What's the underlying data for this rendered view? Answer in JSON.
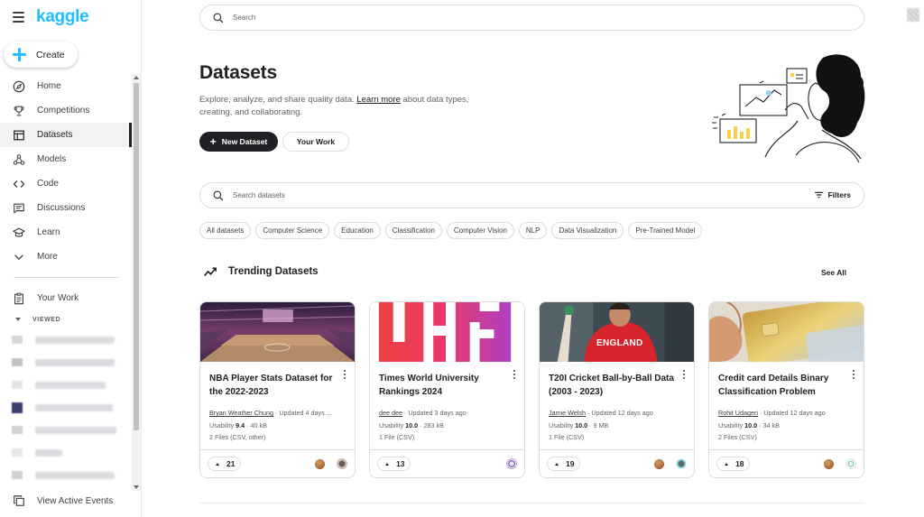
{
  "app": {
    "logo": "kaggle",
    "create_label": "Create",
    "search_placeholder": "Search"
  },
  "sidebar": {
    "items": [
      {
        "label": "Home",
        "icon": "compass-icon"
      },
      {
        "label": "Competitions",
        "icon": "trophy-icon"
      },
      {
        "label": "Datasets",
        "icon": "table-icon",
        "active": true
      },
      {
        "label": "Models",
        "icon": "models-icon"
      },
      {
        "label": "Code",
        "icon": "code-icon"
      },
      {
        "label": "Discussions",
        "icon": "comments-icon"
      },
      {
        "label": "Learn",
        "icon": "graduation-cap-icon"
      },
      {
        "label": "More",
        "icon": "chevron-down-icon"
      }
    ],
    "your_work": "Your Work",
    "viewed_header": "VIEWED",
    "active_events": "View Active Events"
  },
  "page": {
    "title": "Datasets",
    "desc_before": "Explore, analyze, and share quality data. ",
    "learn_more": "Learn more",
    "desc_after": " about data types, creating, and collaborating.",
    "new_dataset": "New Dataset",
    "your_work": "Your Work",
    "search_placeholder": "Search datasets",
    "filters": "Filters"
  },
  "chips": [
    "All datasets",
    "Computer Science",
    "Education",
    "Classification",
    "Computer Vision",
    "NLP",
    "Data Visualization",
    "Pre-Trained Model"
  ],
  "trending": {
    "title": "Trending Datasets",
    "see_all": "See All",
    "cards": [
      {
        "title": "NBA Player Stats Dataset for the 2022-2023",
        "author": "Bryan Weather Chung",
        "updated": " · Updated 4 days ...",
        "usability_label": "Usability ",
        "usability": "9.4",
        "size": " · 40 kB",
        "files": "2 Files (CSV, other)",
        "votes": "21"
      },
      {
        "title": "Times World University Rankings 2024",
        "author": "dee dee",
        "updated": " · Updated 3 days ago",
        "usability_label": "Usability ",
        "usability": "10.0",
        "size": " · 283 kB",
        "files": "1 File (CSV)",
        "votes": "13"
      },
      {
        "title": "T20I Cricket Ball-by-Ball Data (2003 - 2023)",
        "author": "Jamie Welsh",
        "updated": " · Updated 12 days ago",
        "usability_label": "Usability ",
        "usability": "10.0",
        "size": " · 9 MB",
        "files": "1 File (CSV)",
        "votes": "19"
      },
      {
        "title": "Credit card Details Binary Classification Problem",
        "author": "Rohit Udageri",
        "updated": " · Updated 12 days ago",
        "usability_label": "Usability ",
        "usability": "10.0",
        "size": " · 34 kB",
        "files": "2 Files (CSV)",
        "votes": "18"
      }
    ]
  },
  "colors": {
    "brand": "#20beff",
    "primary_text": "#202124",
    "secondary_text": "#5f6368",
    "border": "#dadce0"
  },
  "images": {
    "card_3_jersey": "ENGLAND"
  }
}
